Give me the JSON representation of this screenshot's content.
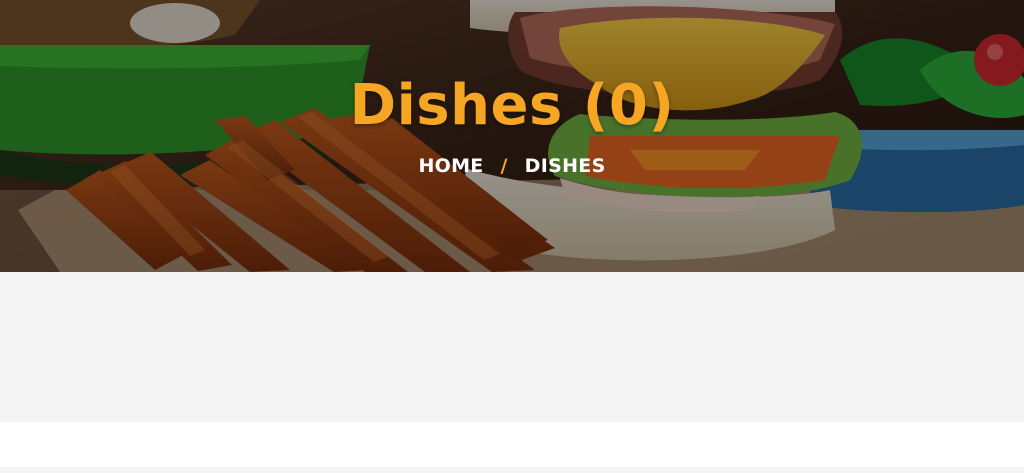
{
  "hero": {
    "title": "Dishes (0)",
    "background": "burger-and-fries-photo",
    "title_color": "#f7a624"
  },
  "breadcrumb": {
    "home": "HOME",
    "separator": "/",
    "current": "DISHES",
    "separator_color": "#f7a624"
  },
  "content": {
    "background": "#f4f4f4"
  }
}
